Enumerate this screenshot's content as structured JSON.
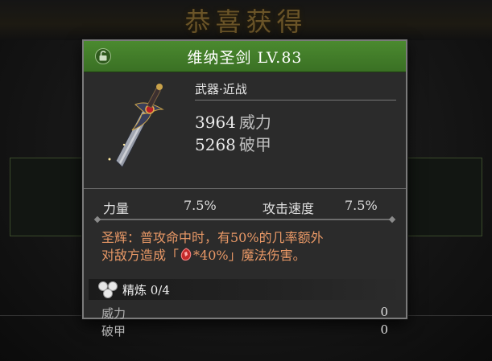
{
  "banner": "恭喜获得",
  "item": {
    "title": "维纳圣剑 LV.83",
    "category": "武器·近战",
    "stats": [
      {
        "value": "3964",
        "label": "威力"
      },
      {
        "value": "5268",
        "label": "破甲"
      }
    ]
  },
  "substats": [
    {
      "label": "力量",
      "value": "7.5%"
    },
    {
      "label": "攻击速度",
      "value": "7.5%"
    }
  ],
  "effect": {
    "line1": "圣辉：普攻命中时，有50%的几率额外",
    "line2_prefix": "对敌方造成「",
    "line2_value": "*40%」魔法伤害。"
  },
  "refine": {
    "label": "精炼 0/4",
    "rows": [
      {
        "label": "威力",
        "value": "0"
      },
      {
        "label": "破甲",
        "value": "0"
      }
    ]
  },
  "icons": {
    "lock": "unlock-icon",
    "weapon": "sword-icon",
    "gem": "red-gem-icon",
    "refine": "refine-orbs-icon"
  },
  "colors": {
    "header_green": "#4b8a2f",
    "effect_text": "#e89866"
  }
}
